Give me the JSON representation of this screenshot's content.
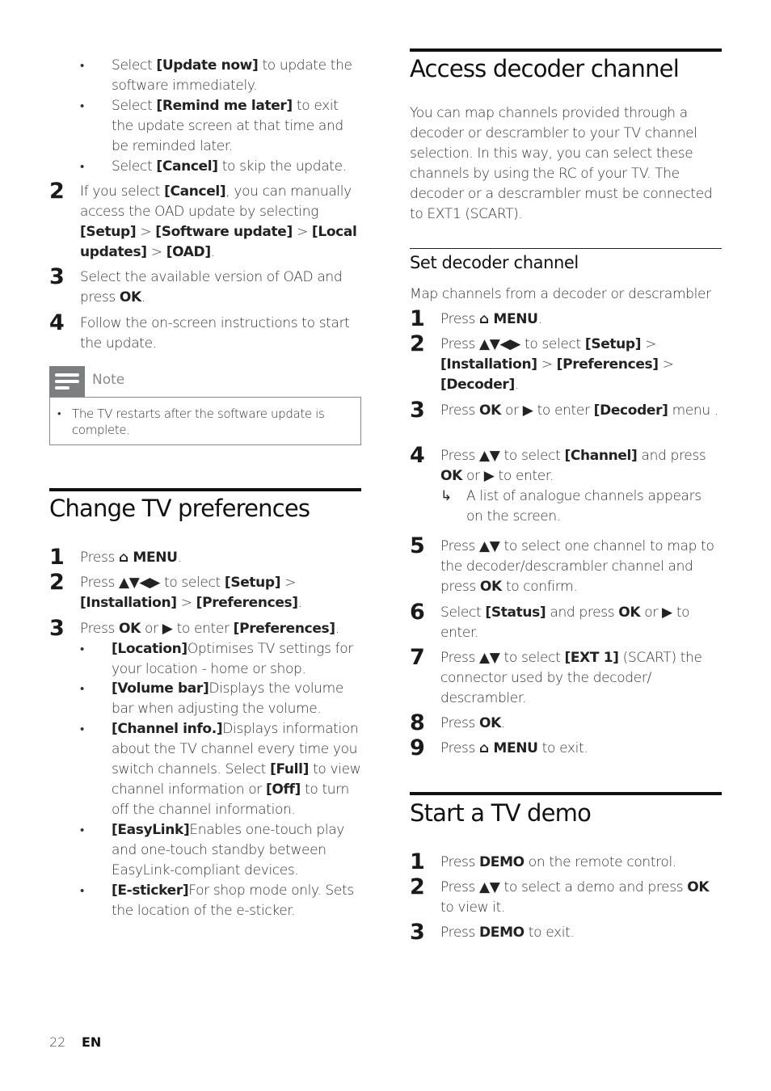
{
  "icons": {
    "home": "⌂",
    "nav4": "▲▼◀▶",
    "nav2": "▲▼",
    "right": "▶",
    "result_arrow": "↳",
    "bullet": "•"
  },
  "left": {
    "bullets_top": [
      [
        {
          "t": "Select "
        },
        {
          "t": "[Update now]",
          "b": true
        },
        {
          "t": " to update the software immediately."
        }
      ],
      [
        {
          "t": "Select "
        },
        {
          "t": "[Remind me later]",
          "b": true
        },
        {
          "t": " to exit the update screen at that time and be reminded later."
        }
      ],
      [
        {
          "t": "Select "
        },
        {
          "t": "[Cancel]",
          "b": true
        },
        {
          "t": " to skip the update."
        }
      ]
    ],
    "steps_top": [
      {
        "n": "2",
        "segs": [
          {
            "t": "If you select "
          },
          {
            "t": "[Cancel]",
            "b": true
          },
          {
            "t": ", you can manually access the OAD update by selecting "
          },
          {
            "t": "[Setup]",
            "b": true
          },
          {
            "t": " > "
          },
          {
            "t": "[Software update]",
            "b": true
          },
          {
            "t": " > "
          },
          {
            "t": "[Local updates]",
            "b": true
          },
          {
            "t": " > "
          },
          {
            "t": "[OAD]",
            "b": true
          },
          {
            "t": "."
          }
        ]
      },
      {
        "n": "3",
        "segs": [
          {
            "t": "Select the available version of OAD and press "
          },
          {
            "t": "OK",
            "b": true
          },
          {
            "t": "."
          }
        ]
      },
      {
        "n": "4",
        "segs": [
          {
            "t": "Follow the on-screen instructions to start the update."
          }
        ]
      }
    ],
    "note": {
      "label": "Note",
      "icon": "note-icon",
      "text": "The TV restarts after the software update is complete."
    },
    "pref": {
      "title": "Change TV preferences",
      "steps": [
        {
          "n": "1",
          "segs": [
            {
              "t": "Press "
            },
            {
              "t": "⌂ MENU",
              "b": true
            },
            {
              "t": "."
            }
          ]
        },
        {
          "n": "2",
          "segs": [
            {
              "t": "Press "
            },
            {
              "t": "▲▼◀▶",
              "b": true
            },
            {
              "t": " to select "
            },
            {
              "t": "[Setup]",
              "b": true
            },
            {
              "t": " > "
            },
            {
              "t": "[Installation]",
              "b": true
            },
            {
              "t": " > "
            },
            {
              "t": "[Preferences]",
              "b": true
            },
            {
              "t": "."
            }
          ]
        },
        {
          "n": "3",
          "segs": [
            {
              "t": "Press "
            },
            {
              "t": "OK",
              "b": true
            },
            {
              "t": " or "
            },
            {
              "t": "▶",
              "b": true
            },
            {
              "t": " to enter "
            },
            {
              "t": "[Preferences]",
              "b": true
            },
            {
              "t": "."
            }
          ]
        }
      ],
      "bullets": [
        [
          {
            "t": "[Location]",
            "b": true
          },
          {
            "t": "Optimises TV settings for your location - home or shop."
          }
        ],
        [
          {
            "t": "[Volume bar]",
            "b": true
          },
          {
            "t": "Displays the volume bar when adjusting the volume."
          }
        ],
        [
          {
            "t": "[Channel info.]",
            "b": true
          },
          {
            "t": "Displays information about the TV channel every time you switch channels. Select "
          },
          {
            "t": "[Full]",
            "b": true
          },
          {
            "t": " to view channel information or "
          },
          {
            "t": "[Off]",
            "b": true
          },
          {
            "t": " to turn off the channel information."
          }
        ],
        [
          {
            "t": "[EasyLink]",
            "b": true
          },
          {
            "t": "Enables one-touch play and one-touch standby between EasyLink-compliant devices."
          }
        ],
        [
          {
            "t": "[E-sticker]",
            "b": true
          },
          {
            "t": "For shop mode only. Sets the location of the e-sticker."
          }
        ]
      ]
    }
  },
  "right": {
    "decoder": {
      "title": "Access decoder channel",
      "intro": "You can map channels provided through a decoder or descrambler to your TV channel selection. In this way, you can select these channels by using the RC of your TV. The decoder or a descrambler must be connected to EXT1 (SCART).",
      "subtitle": "Set decoder channel",
      "lead": "Map channels from a decoder or descrambler",
      "steps": [
        {
          "n": "1",
          "segs": [
            {
              "t": "Press "
            },
            {
              "t": "⌂ MENU",
              "b": true
            },
            {
              "t": "."
            }
          ]
        },
        {
          "n": "2",
          "segs": [
            {
              "t": "Press "
            },
            {
              "t": "▲▼◀▶",
              "b": true
            },
            {
              "t": " to select "
            },
            {
              "t": "[Setup]",
              "b": true
            },
            {
              "t": " > "
            },
            {
              "t": "[Installation]",
              "b": true
            },
            {
              "t": " > "
            },
            {
              "t": "[Preferences]",
              "b": true
            },
            {
              "t": " > "
            },
            {
              "t": "[Decoder]",
              "b": true
            },
            {
              "t": "."
            }
          ]
        },
        {
          "n": "3",
          "segs": [
            {
              "t": "Press "
            },
            {
              "t": "OK",
              "b": true
            },
            {
              "t": " or "
            },
            {
              "t": "▶",
              "b": true
            },
            {
              "t": " to enter "
            },
            {
              "t": "[Decoder]",
              "b": true
            },
            {
              "t": " menu ."
            }
          ]
        },
        {
          "n": "4",
          "segs": [
            {
              "t": "Press "
            },
            {
              "t": "▲▼",
              "b": true
            },
            {
              "t": " to select "
            },
            {
              "t": "[Channel]",
              "b": true
            },
            {
              "t": " and press "
            },
            {
              "t": "OK",
              "b": true
            },
            {
              "t": " or "
            },
            {
              "t": "▶",
              "b": true
            },
            {
              "t": " to enter."
            }
          ]
        },
        {
          "n": "5",
          "segs": [
            {
              "t": "Press "
            },
            {
              "t": "▲▼",
              "b": true
            },
            {
              "t": " to select one channel to map to the decoder/descrambler channel and press "
            },
            {
              "t": "OK",
              "b": true
            },
            {
              "t": " to confirm."
            }
          ]
        },
        {
          "n": "6",
          "segs": [
            {
              "t": "Select "
            },
            {
              "t": "[Status]",
              "b": true
            },
            {
              "t": " and press "
            },
            {
              "t": "OK",
              "b": true
            },
            {
              "t": " or "
            },
            {
              "t": "▶",
              "b": true
            },
            {
              "t": " to enter."
            }
          ]
        },
        {
          "n": "7",
          "segs": [
            {
              "t": "Press "
            },
            {
              "t": "▲▼",
              "b": true
            },
            {
              "t": " to select "
            },
            {
              "t": "[EXT 1]",
              "b": true
            },
            {
              "t": " (SCART) the connector used by the decoder/ descrambler."
            }
          ]
        },
        {
          "n": "8",
          "segs": [
            {
              "t": "Press "
            },
            {
              "t": "OK",
              "b": true
            },
            {
              "t": "."
            }
          ]
        },
        {
          "n": "9",
          "segs": [
            {
              "t": "Press "
            },
            {
              "t": "⌂ MENU",
              "b": true
            },
            {
              "t": " to exit."
            }
          ]
        }
      ],
      "step4_result": "A list of analogue channels appears on the screen."
    },
    "demo": {
      "title": "Start a TV demo",
      "steps": [
        {
          "n": "1",
          "segs": [
            {
              "t": "Press "
            },
            {
              "t": "DEMO",
              "b": true
            },
            {
              "t": " on the remote control."
            }
          ]
        },
        {
          "n": "2",
          "segs": [
            {
              "t": "Press "
            },
            {
              "t": "▲▼",
              "b": true
            },
            {
              "t": " to select a demo and press "
            },
            {
              "t": "OK",
              "b": true
            },
            {
              "t": " to view it."
            }
          ]
        },
        {
          "n": "3",
          "segs": [
            {
              "t": "Press "
            },
            {
              "t": "DEMO",
              "b": true
            },
            {
              "t": " to exit."
            }
          ]
        }
      ]
    }
  },
  "footer": {
    "page": "22",
    "lang": "EN"
  }
}
